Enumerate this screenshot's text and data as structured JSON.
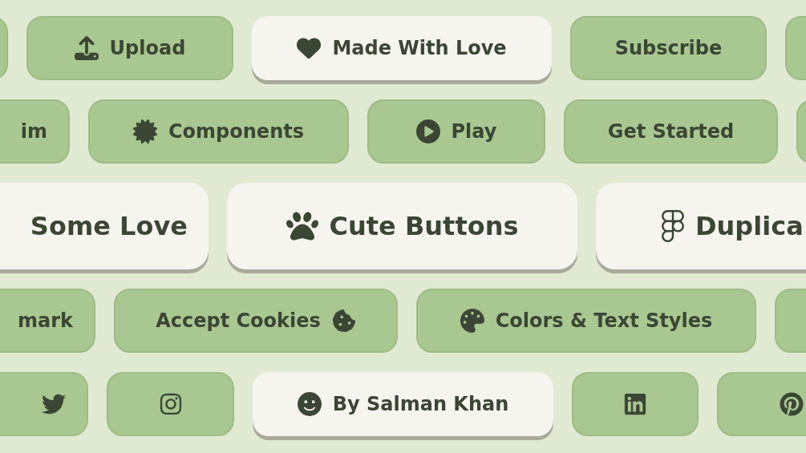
{
  "rows": [
    {
      "buttons": [
        {
          "kind": "blank"
        },
        {
          "kind": "text",
          "label": "Upload"
        },
        {
          "kind": "text",
          "label": "Made With Love"
        },
        {
          "kind": "text",
          "label": "Subscribe"
        },
        {
          "kind": "blank"
        }
      ]
    },
    {
      "buttons": [
        {
          "kind": "text",
          "label": "im"
        },
        {
          "kind": "text",
          "label": "Components"
        },
        {
          "kind": "text",
          "label": "Play"
        },
        {
          "kind": "text",
          "label": "Get Started"
        },
        {
          "kind": "blank"
        }
      ]
    },
    {
      "buttons": [
        {
          "kind": "text",
          "label": "Some Love"
        },
        {
          "kind": "text",
          "label": "Cute Buttons"
        },
        {
          "kind": "text",
          "label": "Duplica"
        }
      ]
    },
    {
      "buttons": [
        {
          "kind": "text",
          "label": "mark"
        },
        {
          "kind": "text",
          "label": "Accept Cookies"
        },
        {
          "kind": "text",
          "label": "Colors & Text Styles"
        },
        {
          "kind": "blank"
        }
      ]
    },
    {
      "buttons": [
        {
          "kind": "icon"
        },
        {
          "kind": "icon"
        },
        {
          "kind": "text",
          "label": "By Salman Khan"
        },
        {
          "kind": "icon"
        },
        {
          "kind": "icon"
        }
      ]
    }
  ]
}
